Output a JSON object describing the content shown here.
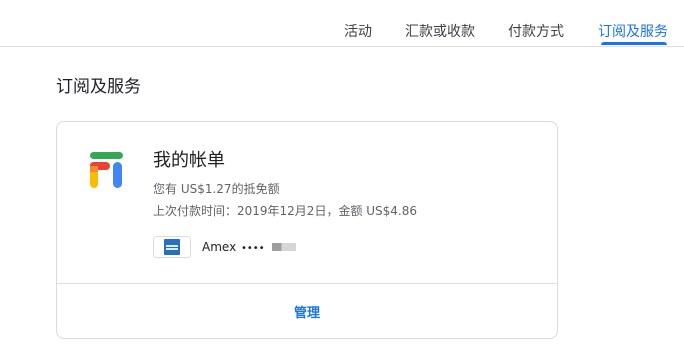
{
  "nav": {
    "tabs": [
      {
        "label": "活动"
      },
      {
        "label": "汇款或收款"
      },
      {
        "label": "付款方式"
      },
      {
        "label": "订阅及服务",
        "active": true
      }
    ],
    "accent_color": "#1a73e8"
  },
  "page_title": "订阅及服务",
  "card": {
    "logo_icon": "google-fi-logo",
    "title": "我的帐单",
    "credit_text": "您有 US$1.27的抵免额",
    "last_payment_text": "上次付款时间：2019年12月2日，金额 US$4.86",
    "payment_method": {
      "icon": "amex-card-icon",
      "name": "Amex",
      "dots": "••••"
    },
    "manage_label": "管理"
  }
}
